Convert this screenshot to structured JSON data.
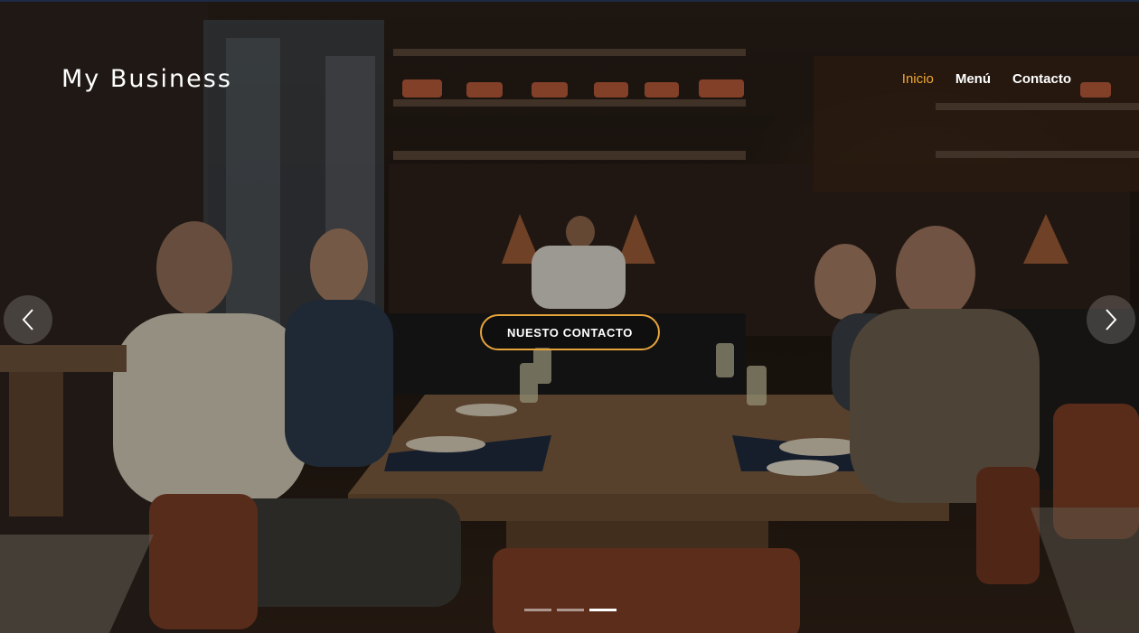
{
  "brand": {
    "name": "My Business"
  },
  "nav": {
    "items": [
      {
        "label": "Inicio",
        "active": true
      },
      {
        "label": "Menú",
        "active": false
      },
      {
        "label": "Contacto",
        "active": false
      }
    ],
    "active_color": "#f0a830"
  },
  "hero": {
    "cta_label": "NUESTO CONTACTO",
    "cta_border_color": "#e7a43a",
    "prev_icon": "chevron-left-icon",
    "next_icon": "chevron-right-icon"
  },
  "carousel": {
    "slide_count": 3,
    "active_index": 2
  }
}
